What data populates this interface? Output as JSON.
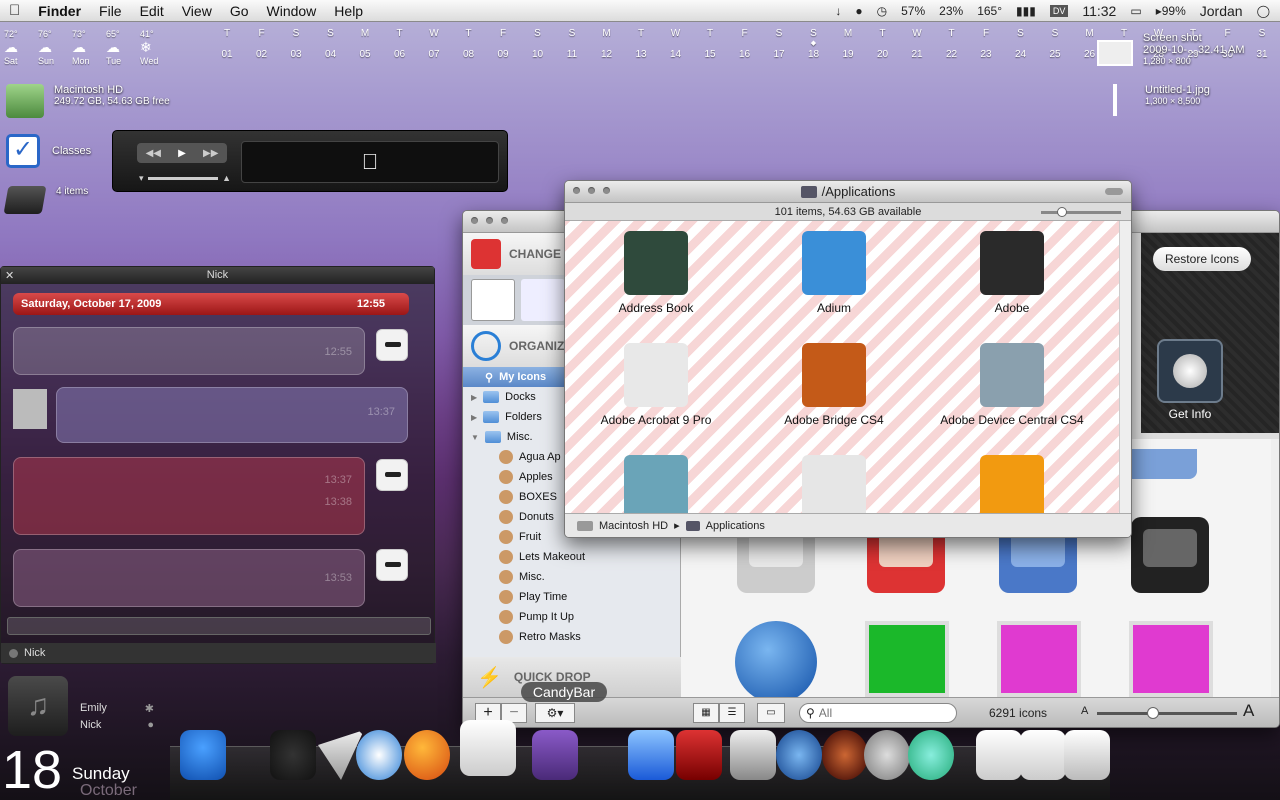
{
  "menubar": {
    "apple": "",
    "app": "Finder",
    "items": [
      "File",
      "Edit",
      "View",
      "Go",
      "Window",
      "Help"
    ],
    "status": {
      "cpu": "57%",
      "mem": "23%",
      "temp": "165°",
      "battery": "99%",
      "user": "Jordan",
      "time": "11:32",
      "dv": "DV"
    }
  },
  "weather": [
    {
      "temp": "72°",
      "day": "Sat"
    },
    {
      "temp": "76°",
      "day": "Sun"
    },
    {
      "temp": "73°",
      "day": "Mon"
    },
    {
      "temp": "65°",
      "day": "Tue"
    },
    {
      "temp": "41°",
      "day": "Wed"
    }
  ],
  "calendar": {
    "days": [
      "T",
      "F",
      "S",
      "S",
      "M",
      "T",
      "W",
      "T",
      "F",
      "S",
      "S",
      "M",
      "T",
      "W",
      "T",
      "F",
      "S",
      "S",
      "M",
      "T",
      "W",
      "T",
      "F",
      "S",
      "S",
      "M",
      "T",
      "W",
      "T",
      "F",
      "S"
    ],
    "dates": [
      "01",
      "02",
      "03",
      "04",
      "05",
      "06",
      "07",
      "08",
      "09",
      "10",
      "11",
      "12",
      "13",
      "14",
      "15",
      "16",
      "17",
      "18",
      "19",
      "20",
      "21",
      "22",
      "23",
      "24",
      "25",
      "26",
      "27",
      "28",
      "29",
      "30",
      "31"
    ]
  },
  "desktop": {
    "hd_name": "Macintosh HD ",
    "hd_info": "249.72 GB, 54.63 GB free",
    "classes": "Classes",
    "folder_name": "",
    "folder_items": "4 items",
    "file1_name": "Screen shot",
    "file1_line2": "2009-10-…32.41 AM",
    "file1_size": "1,280 × 800",
    "file2_name": "Untitled-1.jpg",
    "file2_size": "1,300 × 8,500"
  },
  "chat": {
    "title": "Nick",
    "date": "Saturday, October 17, 2009",
    "time": "12:55",
    "messages": [
      {
        "time": "12:55"
      },
      {
        "time": "13:37"
      },
      {
        "time": "13:37"
      },
      {
        "time": "13:38"
      },
      {
        "time": "13:53"
      }
    ],
    "footer_name": "Nick"
  },
  "contacts": [
    {
      "name": "Emily"
    },
    {
      "name": "Nick"
    }
  ],
  "clock": {
    "day_num": "18",
    "weekday": "Sunday",
    "month": "October"
  },
  "candybar": {
    "change": "CHANGE",
    "organize": "ORGANIZE",
    "quick_drop": "QUICK DROP",
    "restore": "Restore Icons",
    "get_info": "Get Info",
    "search_placeholder": "All",
    "count": "6291 icons",
    "tooltip": "CandyBar",
    "sidebar": {
      "header": "My Icons",
      "items": [
        {
          "label": "Docks"
        },
        {
          "label": "Folders"
        },
        {
          "label": "Misc."
        },
        {
          "label": "Agua Ap"
        },
        {
          "label": "Apples"
        },
        {
          "label": "BOXES"
        },
        {
          "label": "Donuts"
        },
        {
          "label": "Fruit"
        },
        {
          "label": "Lets Makeout"
        },
        {
          "label": "Misc."
        },
        {
          "label": "Play Time"
        },
        {
          "label": "Pump It Up"
        },
        {
          "label": "Retro Masks"
        }
      ]
    }
  },
  "finder": {
    "title": "/Applications",
    "status": "101 items, 54.63 GB available",
    "apps": [
      {
        "name": "Address Book",
        "color": "#2f4a3c"
      },
      {
        "name": "Adium",
        "color": "#3a8fd8"
      },
      {
        "name": "Adobe",
        "color": "#2a2a2a"
      },
      {
        "name": "Adobe Acrobat 9 Pro",
        "color": "#e8e8e8"
      },
      {
        "name": "Adobe Bridge CS4",
        "color": "#c45a18"
      },
      {
        "name": "Adobe Device Central CS4",
        "color": "#8aa0ae"
      },
      {
        "name": "",
        "color": "#6aa4b8"
      },
      {
        "name": "",
        "color": "#e6e6e6"
      },
      {
        "name": "",
        "color": "#f29a10"
      }
    ],
    "path": [
      "Macintosh HD ",
      "Applications"
    ]
  }
}
